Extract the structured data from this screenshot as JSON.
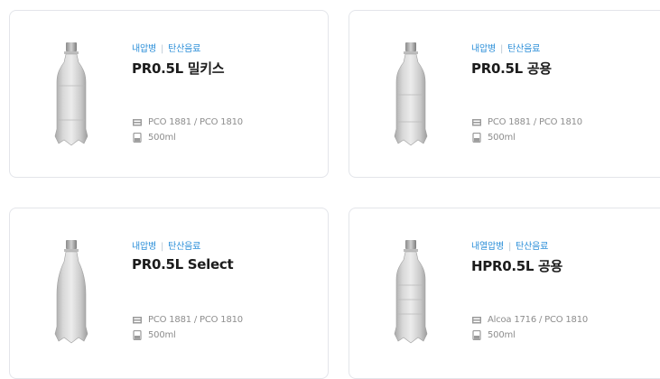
{
  "products": [
    {
      "category": "내압병",
      "type": "탄산음료",
      "name": "PR0.5L 밀키스",
      "closure": "PCO 1881 / PCO 1810",
      "volume": "500ml",
      "icons": {
        "closure": "cap-spec-icon",
        "volume": "bottle-volume-icon"
      }
    },
    {
      "category": "내압병",
      "type": "탄산음료",
      "name": "PR0.5L 공용",
      "closure": "PCO 1881 / PCO 1810",
      "volume": "500ml",
      "icons": {
        "closure": "cap-spec-icon",
        "volume": "bottle-volume-icon"
      }
    },
    {
      "category": "내압병",
      "type": "탄산음료",
      "name": "PR0.5L Select",
      "closure": "PCO 1881 / PCO 1810",
      "volume": "500ml",
      "icons": {
        "closure": "cap-spec-icon",
        "volume": "bottle-volume-icon"
      }
    },
    {
      "category": "내열압병",
      "type": "탄산음료",
      "name": "HPR0.5L 공용",
      "closure": "Alcoa 1716 / PCO 1810",
      "volume": "500ml",
      "icons": {
        "closure": "cap-spec-icon",
        "volume": "bottle-volume-icon"
      }
    }
  ],
  "colors": {
    "tag": "#2a8ed8",
    "title": "#1c1c1c",
    "spec": "#8d8d8d",
    "border": "#e3e5ea"
  }
}
